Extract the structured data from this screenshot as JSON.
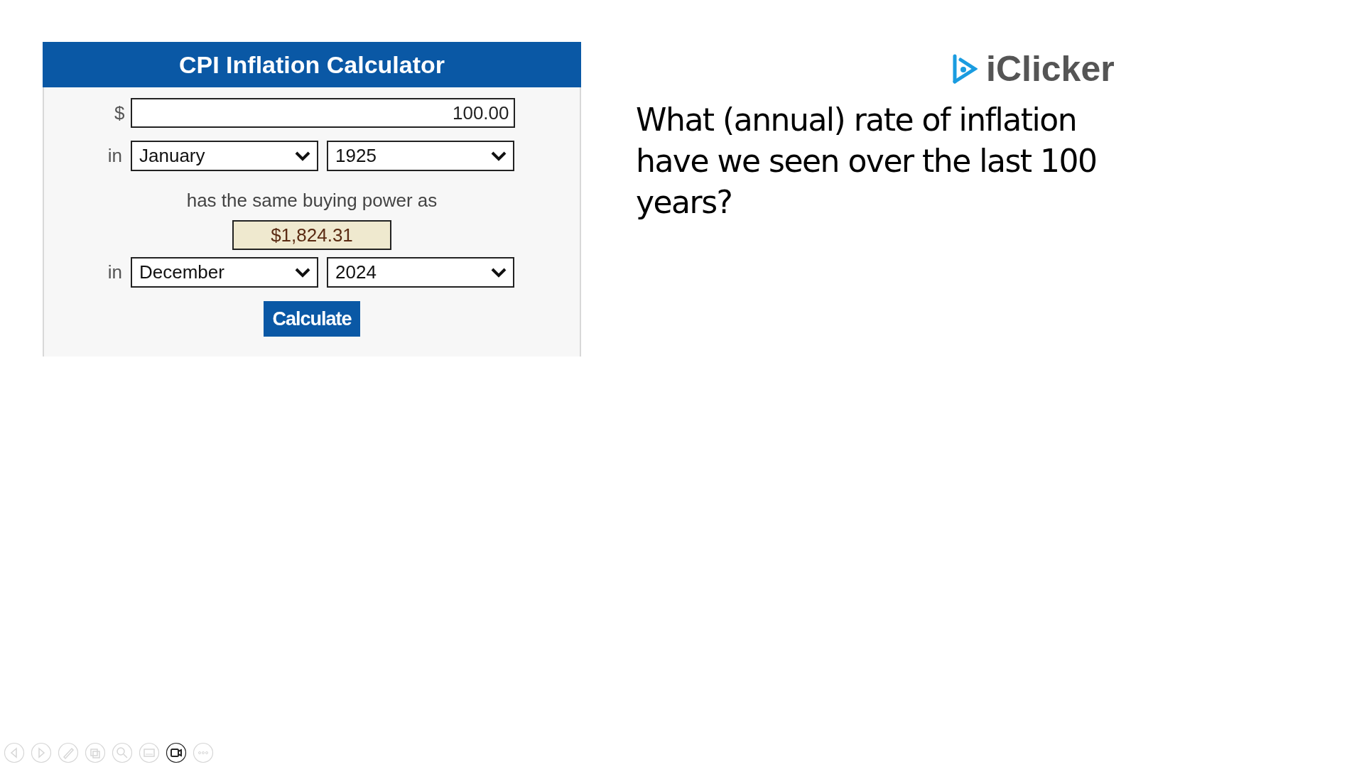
{
  "calculator": {
    "title": "CPI Inflation Calculator",
    "currency_label": "$",
    "amount": "100.00",
    "from": {
      "label": "in",
      "month": "January",
      "year": "1925"
    },
    "middle_text": "has the same buying power as",
    "result": "$1,824.31",
    "to": {
      "label": "in",
      "month": "December",
      "year": "2024"
    },
    "button": "Calculate"
  },
  "logo": {
    "text": "iClicker"
  },
  "question": "What (annual) rate of inflation have we seen over the last 100 years?",
  "toolbar": [
    {
      "kind": "previous",
      "disabled": true
    },
    {
      "kind": "next",
      "disabled": true
    },
    {
      "kind": "pen",
      "disabled": true
    },
    {
      "kind": "slides",
      "disabled": true
    },
    {
      "kind": "zoom",
      "disabled": true
    },
    {
      "kind": "subtitles",
      "disabled": true
    },
    {
      "kind": "camera",
      "disabled": false
    },
    {
      "kind": "more",
      "disabled": true
    }
  ]
}
